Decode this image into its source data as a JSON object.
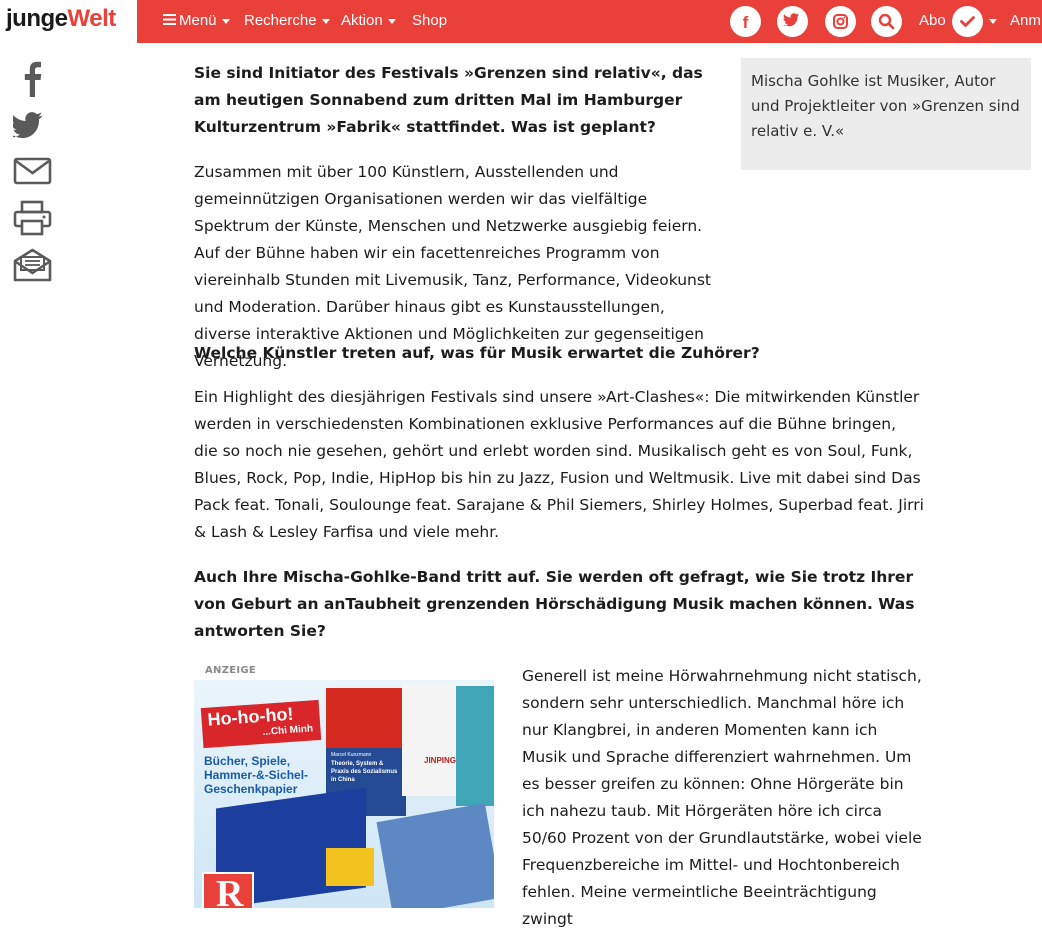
{
  "header": {
    "logo_part1": "junge",
    "logo_part2": "Welt",
    "nav": [
      "Menü",
      "Recherche",
      "Aktion",
      "Shop"
    ],
    "social_icons": [
      "facebook-icon",
      "twitter-icon",
      "instagram-icon",
      "search-icon"
    ],
    "abo_label": "Abo",
    "login_label": "Anm"
  },
  "share_icons": [
    "facebook-icon",
    "twitter-icon",
    "mail-icon",
    "print-icon",
    "newsletter-icon"
  ],
  "colors": {
    "brand_red": "#e9403a",
    "aside_bg": "#ececec"
  },
  "aside": {
    "text": "Mischa Gohlke ist Musiker, Autor und Projektleiter von »Grenzen sind relativ e. V.«"
  },
  "article": {
    "q1": "Sie sind Initiator des Festivals »Grenzen sind relativ«, das am heutigen Sonnabend zum dritten Mal im Hamburger Kulturzentrum »Fabrik« stattfindet. Was ist geplant?",
    "a1": "Zusammen mit über 100 Künstlern, Ausstellenden und gemeinnützigen Organisationen werden wir das vielfältige Spektrum der Künste, Menschen und Netzwerke ausgiebig feiern. Auf der Bühne haben wir ein facettenreiches Programm von viereinhalb Stunden mit Livemusik, Tanz, Performance, Videokunst und Moderation. Darüber hinaus gibt es Kunstausstellungen, diverse interaktive Aktionen und Möglichkeiten zur gegenseitigen Vernetzung.",
    "q2": "Welche Künstler treten auf, was für Musik erwartet die Zuhörer?",
    "a2": "Ein Highlight des diesjährigen Festivals sind unsere »Art-Clashes«: Die mitwirkenden Künstler werden in verschiedensten Kombinationen exklusive Performances auf die Bühne bringen, die so noch nie gesehen, gehört und erlebt worden sind. Musikalisch geht es von Soul, Funk, Blues, Rock, Pop, Indie, HipHop bis hin zu Jazz, Fusion und Weltmusik. Live mit dabei sind Das Pack feat. Tonali, Soulounge feat. Sarajane & Phil Siemers, Shirley Holmes, Superbad feat. Jirri & Lash & Lesley Farfisa und viele mehr.",
    "q3": "Auch Ihre Mischa-Gohlke-Band tritt auf. Sie werden oft gefragt, wie Sie trotz Ihrer von Geburt an anTaubheit grenzenden Hörschädigung Musik machen können. Was antworten Sie?",
    "a3": "Generell ist meine Hörwahrnehmung nicht statisch, sondern sehr unterschiedlich. Manchmal höre ich nur Klangbrei, in anderen Momenten kann ich Musik und Sprache differenziert wahrnehmen. Um es besser greifen zu können: Ohne Hörgeräte bin ich nahezu taub. Mit Hörgeräten höre ich circa 50/60 Prozent von der Grundlautstärke, wobei viele Frequenzbereiche im Mittel- und Hochtonbereich fehlen. Meine vermeintliche Beeinträchtigung zwingt"
  },
  "ad": {
    "label": "ANZEIGE",
    "headline": "Ho-ho-ho!",
    "subline": "...Chi Minh",
    "tagline": "Bücher, Spiele, Hammer-&-Sichel-Geschenkpapier",
    "book_author": "Marcel Kunzmann",
    "book_title": "Theorie, System & Praxis des Sozialismus in China",
    "book_name": "JINPING",
    "logo_letter": "R"
  }
}
